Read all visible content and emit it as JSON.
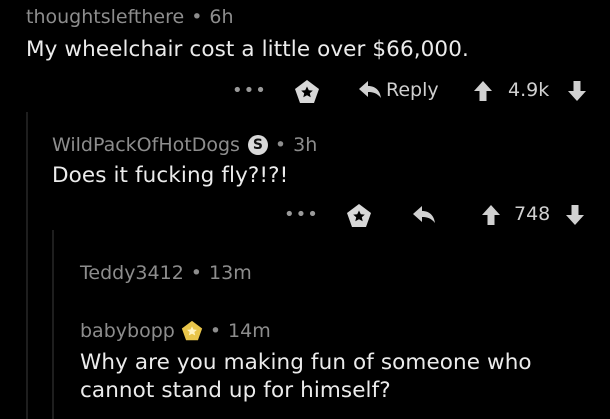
{
  "comments": [
    {
      "author": "thoughtslefthere",
      "time": "6h",
      "text": "My wheelchair cost a little over $66,000.",
      "reply_label": "Reply",
      "score": "4.9k"
    },
    {
      "author": "WildPackOfHotDogs",
      "time": "3h",
      "text": "Does it fucking fly?!?!",
      "score": "748",
      "badge": "S"
    },
    {
      "author": "Teddy3412",
      "time": "13m"
    },
    {
      "author": "babybopp",
      "time": "14m",
      "text": "Why are you making fun of someone who cannot stand up for himself?"
    }
  ],
  "separator": "•",
  "more_label": "•••",
  "colors": {
    "background": "#000000",
    "meta_text": "#8d8d8d",
    "body_text": "#ececec",
    "award_gold": "#e8c54a",
    "thread_line": "#1e1e1e"
  },
  "icons": [
    "more-icon",
    "award-icon",
    "reply-arrow-icon",
    "upvote-icon",
    "downvote-icon",
    "user-badge-icon",
    "gold-award-icon"
  ]
}
